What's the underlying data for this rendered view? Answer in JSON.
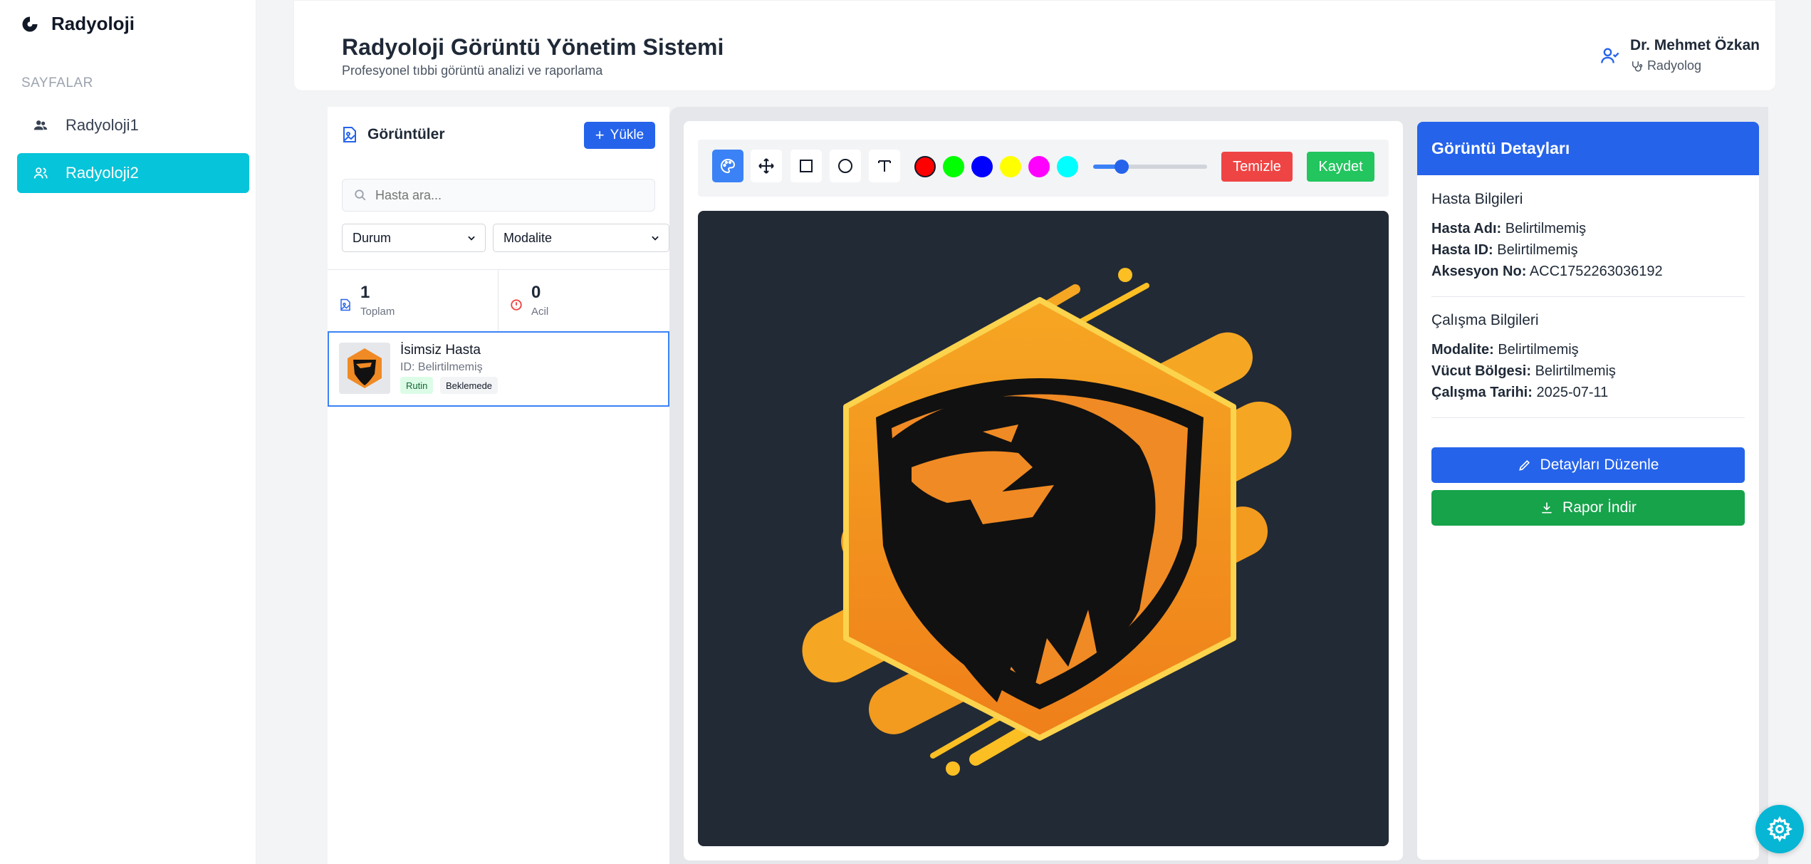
{
  "app": {
    "brand": "Radyoloji"
  },
  "sidebar": {
    "section_label": "SAYFALAR",
    "items": [
      {
        "label": "Radyoloji1",
        "icon": "users-icon",
        "active": false
      },
      {
        "label": "Radyoloji2",
        "icon": "user-group-icon",
        "active": true
      }
    ]
  },
  "header": {
    "title": "Radyoloji Görüntü Yönetim Sistemi",
    "subtitle": "Profesyonel tıbbi görüntü analizi ve raporlama",
    "user_name": "Dr. Mehmet Özkan",
    "user_role": "Radyolog"
  },
  "images_panel": {
    "title": "Görüntüler",
    "upload_label": "Yükle",
    "search_placeholder": "Hasta ara...",
    "filter_status": "Durum",
    "filter_modality": "Modalite",
    "stats": [
      {
        "value": "1",
        "label": "Toplam"
      },
      {
        "value": "0",
        "label": "Acil"
      }
    ],
    "patients": [
      {
        "name": "İsimsiz Hasta",
        "id_text": "ID: Belirtilmemiş",
        "priority": "Rutin",
        "status": "Beklemede"
      }
    ]
  },
  "toolbar": {
    "tools": [
      "palette-icon",
      "move-icon",
      "rectangle-icon",
      "circle-icon",
      "text-icon"
    ],
    "colors": [
      "#ff0000",
      "#00ff00",
      "#0000ff",
      "#ffff00",
      "#ff00ff",
      "#00ffff"
    ],
    "selected_color": "#ff0000",
    "brush_size_fraction": 0.25,
    "clear_label": "Temizle",
    "save_label": "Kaydet"
  },
  "details": {
    "title": "Görüntü Detayları",
    "patient_section": "Hasta Bilgileri",
    "patient_name_label": "Hasta Adı:",
    "patient_name": "Belirtilmemiş",
    "patient_id_label": "Hasta ID:",
    "patient_id": "Belirtilmemiş",
    "accession_label": "Aksesyon No:",
    "accession": "ACC1752263036192",
    "study_section": "Çalışma Bilgileri",
    "modality_label": "Modalite:",
    "modality": "Belirtilmemiş",
    "body_region_label": "Vücut Bölgesi:",
    "body_region": "Belirtilmemiş",
    "study_date_label": "Çalışma Tarihi:",
    "study_date": "2025-07-11",
    "edit_label": "Detayları Düzenle",
    "report_label": "Rapor İndir"
  },
  "colors": {
    "accent_cyan": "#06c4d9",
    "primary_blue": "#2563eb",
    "danger_red": "#ef4444",
    "success_green": "#22c55e"
  }
}
